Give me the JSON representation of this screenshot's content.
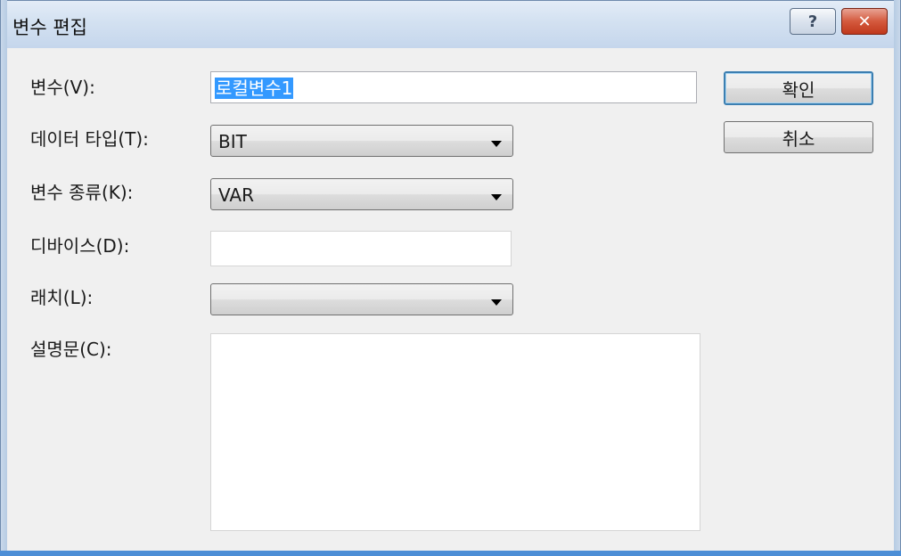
{
  "window": {
    "title": "변수 편집",
    "help_label": "?",
    "close_label": "✕"
  },
  "form": {
    "variable_label": "변수(V):",
    "variable_value": "로컬변수1",
    "datatype_label": "데이터 타입(T):",
    "datatype_value": "BIT",
    "kind_label": "변수 종류(K):",
    "kind_value": "VAR",
    "device_label": "디바이스(D):",
    "device_value": "",
    "latch_label": "래치(L):",
    "latch_value": "",
    "comment_label": "설명문(C):",
    "comment_value": ""
  },
  "buttons": {
    "ok": "확인",
    "cancel": "취소"
  },
  "colors": {
    "selection": "#3399ff",
    "title_accent": "#4c8ed6",
    "close": "#c0391c"
  }
}
